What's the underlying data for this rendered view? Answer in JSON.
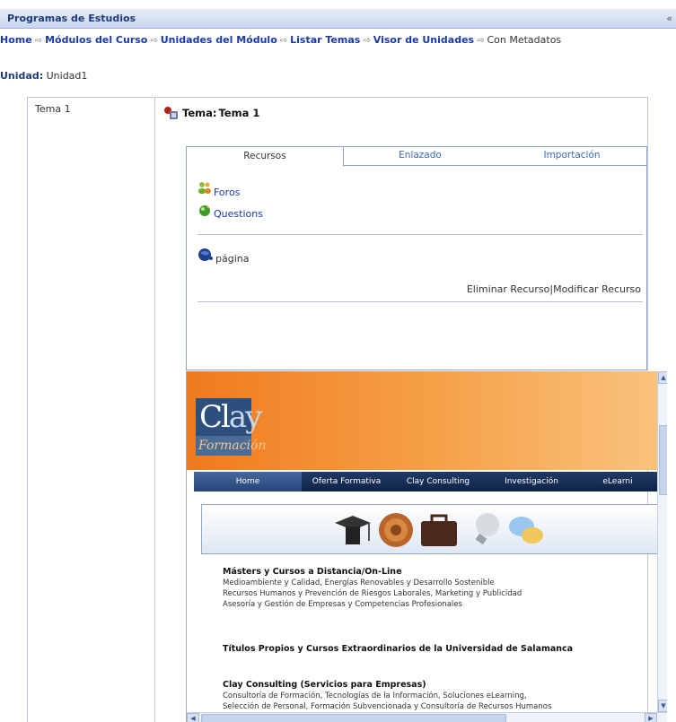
{
  "window": {
    "title": "Programas de Estudios",
    "collapse_glyph": "«"
  },
  "breadcrumb": {
    "items": [
      "Home",
      "Módulos del Curso",
      "Unidades del Módulo",
      "Listar Temas",
      "Visor de Unidades"
    ],
    "current": "Con Metadatos"
  },
  "unidad": {
    "label": "Unidad:",
    "value": "Unidad1"
  },
  "tema_list": {
    "item": "Tema 1"
  },
  "tema": {
    "label": "Tema:",
    "name": "Tema 1",
    "icon": "tema-icon"
  },
  "tabs": [
    {
      "label": "Recursos",
      "active": true
    },
    {
      "label": "Enlazado",
      "active": false
    },
    {
      "label": "Importación",
      "active": false
    }
  ],
  "resources": [
    {
      "label": "Foros",
      "icon": "people-icon"
    },
    {
      "label": "Questions",
      "icon": "question-icon"
    }
  ],
  "page_resource": {
    "label": "página",
    "icon": "globe-icon"
  },
  "actions": {
    "delete": "Eliminar Recurso",
    "separator": "|",
    "modify": "Modificar Recurso"
  },
  "site": {
    "logo_main": "Cl",
    "logo_accent": "ay",
    "logo_sub": "Formación",
    "nav": [
      "Home",
      "Oferta Formativa",
      "Clay Consulting",
      "Investigación",
      "eLearni"
    ],
    "sections": [
      {
        "heading": "Másters y Cursos a Distancia/On-Line",
        "lines": [
          "Medioambiente y Calidad, Energías Renovables y Desarrollo Sostenible",
          "Recursos Humanos y Prevención de Riesgos Laborales, Marketing y Publicidad",
          "Asesoría y Gestión de Empresas y Competencias Profesionales"
        ]
      },
      {
        "heading": "Títulos Propios y Cursos Extraordinarios de la Universidad de Salamanca",
        "lines": []
      },
      {
        "heading": "Clay Consulting (Servicios para Empresas)",
        "lines": [
          "Consultoría de Formación, Tecnologías de la Información, Soluciones eLearning,",
          "Selección de Personal, Formación Subvencionada y Consultoría de Recursos Humanos"
        ]
      }
    ]
  },
  "colors": {
    "link": "#1a3aa8",
    "header_orange": "#f07a1e",
    "nav_dark": "#0f2448",
    "logo_blue": "#2d4f7d"
  }
}
